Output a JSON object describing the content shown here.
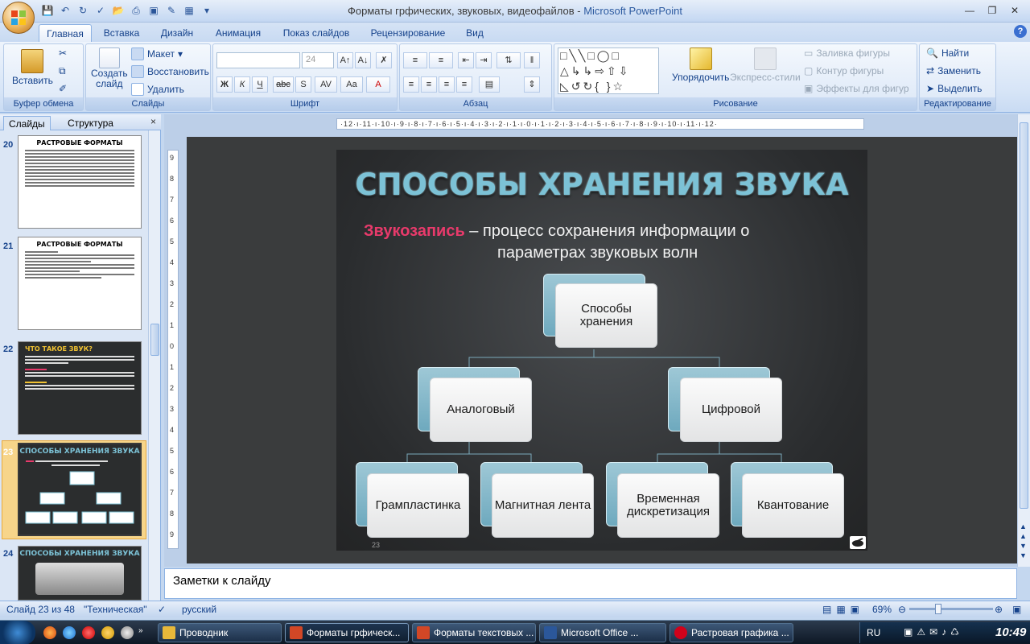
{
  "window": {
    "title": "Форматы грфических, звуковых, видеофайлов",
    "app": "Microsoft PowerPoint"
  },
  "tabs": [
    "Главная",
    "Вставка",
    "Дизайн",
    "Анимация",
    "Показ слайдов",
    "Рецензирование",
    "Вид"
  ],
  "ribbon": {
    "clipboard": {
      "label": "Буфер обмена",
      "paste": "Вставить"
    },
    "slides": {
      "label": "Слайды",
      "create": "Создать",
      "create2": "слайд",
      "layout": "Макет",
      "reset": "Восстановить",
      "delete": "Удалить"
    },
    "font": {
      "label": "Шрифт",
      "size": "24",
      "bold": "Ж",
      "italic": "К",
      "underline": "Ч",
      "strike": "abc",
      "shadow": "S"
    },
    "paragraph": {
      "label": "Абзац"
    },
    "drawing": {
      "label": "Рисование",
      "arrange": "Упорядочить",
      "quick_styles": "Экспресс-стили",
      "fill": "Заливка фигуры",
      "outline": "Контур фигуры",
      "effects": "Эффекты для фигур"
    },
    "editing": {
      "label": "Редактирование",
      "find": "Найти",
      "replace": "Заменить",
      "select": "Выделить"
    }
  },
  "left_panel": {
    "tab_slides": "Слайды",
    "tab_outline": "Структура",
    "close": "×",
    "thumbs": [
      {
        "num": "20",
        "title": "РАСТРОВЫЕ ФОРМАТЫ"
      },
      {
        "num": "21",
        "title": "РАСТРОВЫЕ ФОРМАТЫ"
      },
      {
        "num": "22",
        "title": "ЧТО ТАКОЕ ЗВУК?"
      },
      {
        "num": "23",
        "title": "СПОСОБЫ ХРАНЕНИЯ ЗВУКА"
      },
      {
        "num": "24",
        "title": "СПОСОБЫ ХРАНЕНИЯ ЗВУКА"
      }
    ]
  },
  "ruler": "·12·ı·11·ı·10·ı·9·ı·8·ı·7·ı·6·ı·5·ı·4·ı·3·ı·2·ı·1·ı·0·ı·1·ı·2·ı·3·ı·4·ı·5·ı·6·ı·7·ı·8·ı·9·ı·10·ı·11·ı·12·",
  "vruler": [
    "9",
    "8",
    "7",
    "6",
    "5",
    "4",
    "3",
    "2",
    "1",
    "0",
    "1",
    "2",
    "3",
    "4",
    "5",
    "6",
    "7",
    "8",
    "9"
  ],
  "slide": {
    "title": "СПОСОБЫ ХРАНЕНИЯ ЗВУКА",
    "highlight": "Звукозапись",
    "line1": " – процесс сохранения информации о",
    "line2": "параметрах  звуковых волн",
    "nodes": {
      "root": "Способы хранения",
      "analog": "Аналоговый",
      "digital": "Цифровой",
      "record": "Грампластинка",
      "tape": "Магнитная лента",
      "sampling": "Временная дискретизация",
      "quant": "Квантование"
    },
    "number": "23"
  },
  "notes_placeholder": "Заметки к слайду",
  "status": {
    "slide_of": "Слайд 23 из 48",
    "theme": "\"Техническая\"",
    "lang": "русский",
    "zoom": "69%"
  },
  "taskbar": {
    "items": [
      "Проводник",
      "Форматы грфическ...",
      "Форматы текстовых ...",
      "Microsoft Office ...",
      "Растровая графика ..."
    ],
    "lang": "RU",
    "time": "10:49"
  }
}
